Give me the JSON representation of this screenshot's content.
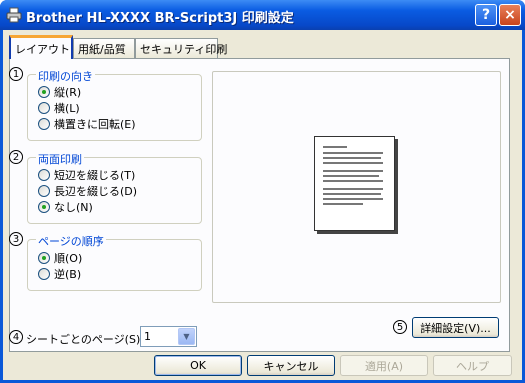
{
  "window": {
    "title": "Brother HL-XXXX BR-Script3J 印刷設定",
    "help_glyph": "?",
    "close_glyph": "×",
    "icons": [
      "printer-icon",
      "help-icon",
      "close-icon"
    ]
  },
  "tabs": [
    {
      "label": "レイアウト",
      "active": true
    },
    {
      "label": "用紙/品質",
      "active": false
    },
    {
      "label": "セキュリティ印刷",
      "active": false
    }
  ],
  "orientation": {
    "number": "1",
    "label": "印刷の向き",
    "options": [
      {
        "label": "縦(R)",
        "checked": true
      },
      {
        "label": "横(L)",
        "checked": false
      },
      {
        "label": "横置きに回転(E)",
        "checked": false
      }
    ]
  },
  "duplex": {
    "number": "2",
    "label": "両面印刷",
    "options": [
      {
        "label": "短辺を綴じる(T)",
        "checked": false
      },
      {
        "label": "長辺を綴じる(D)",
        "checked": false
      },
      {
        "label": "なし(N)",
        "checked": true
      }
    ]
  },
  "page_order": {
    "number": "3",
    "label": "ページの順序",
    "options": [
      {
        "label": "順(O)",
        "checked": true
      },
      {
        "label": "逆(B)",
        "checked": false
      }
    ]
  },
  "pages_per_sheet": {
    "number": "4",
    "label": "シートごとのページ(S):",
    "value": "1"
  },
  "advanced": {
    "number": "5",
    "label": "詳細設定(V)..."
  },
  "footer": {
    "ok": "OK",
    "cancel": "キャンセル",
    "apply": "適用(A)",
    "help": "ヘルプ"
  }
}
